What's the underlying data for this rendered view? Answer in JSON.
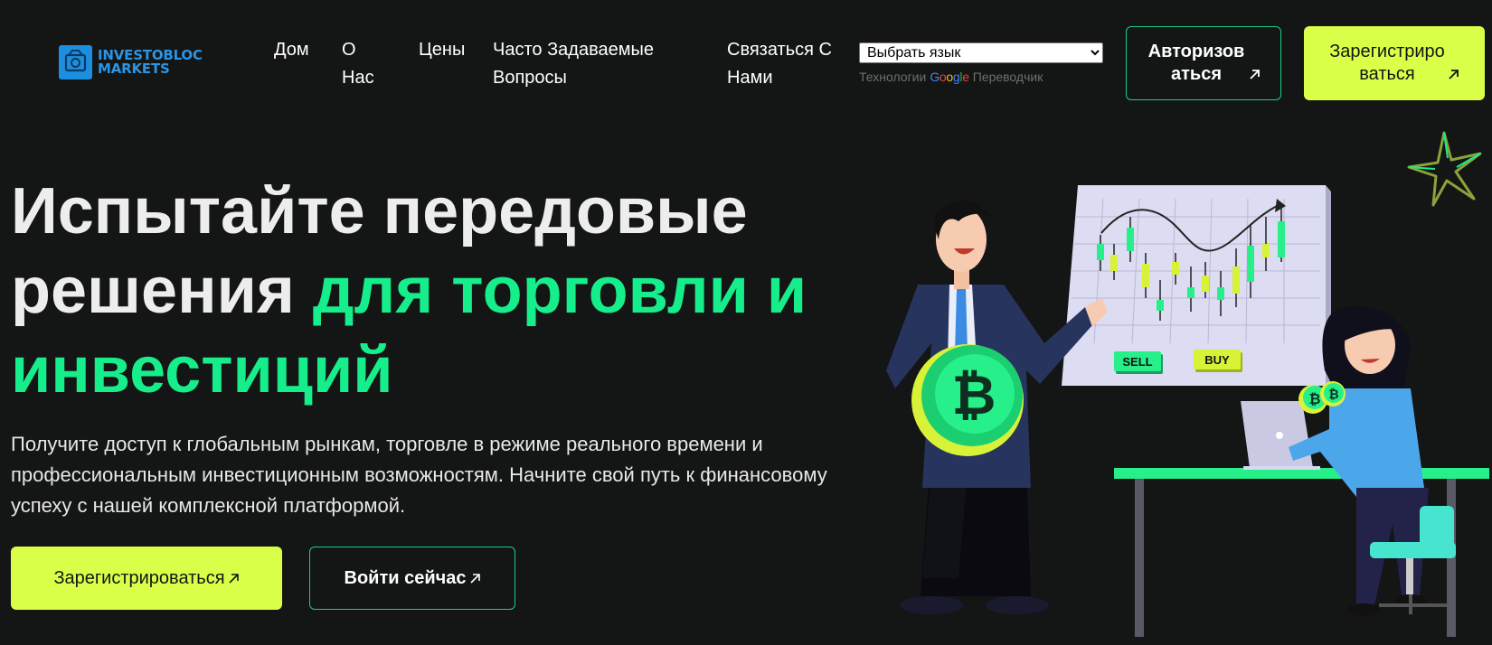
{
  "brand": {
    "line1": "INVESTOBLOC",
    "line2": "MARKETS",
    "color": "#2b94e4"
  },
  "nav": {
    "home": "Дом",
    "about": "О Нас",
    "prices": "Цены",
    "faq": "Часто Задаваемые Вопросы",
    "contact": "Связаться С Нами"
  },
  "translate": {
    "selected": "Выбрать язык",
    "powered_prefix": "Технологии",
    "google": "Google",
    "link": "Переводчик"
  },
  "header_buttons": {
    "login": "Авторизоваться",
    "register": "Зарегистрироваться"
  },
  "hero": {
    "title_plain": "Испытайте передовые решения ",
    "title_accent": "для торговли и инвестиций",
    "subtitle": "Получите доступ к глобальным рынкам, торговле в режиме реального времени и профессиональным инвестиционным возможностям. Начните свой путь к финансовому успеху с нашей комплексной платформой.",
    "cta_register": "Зарегистрироваться",
    "cta_login": "Войти сейчас"
  },
  "illustration": {
    "sell_label": "SELL",
    "buy_label": "BUY"
  },
  "colors": {
    "background": "#141515",
    "accent_green": "#16ee8c",
    "lime": "#daff48",
    "outline_green": "#1bcf83"
  }
}
